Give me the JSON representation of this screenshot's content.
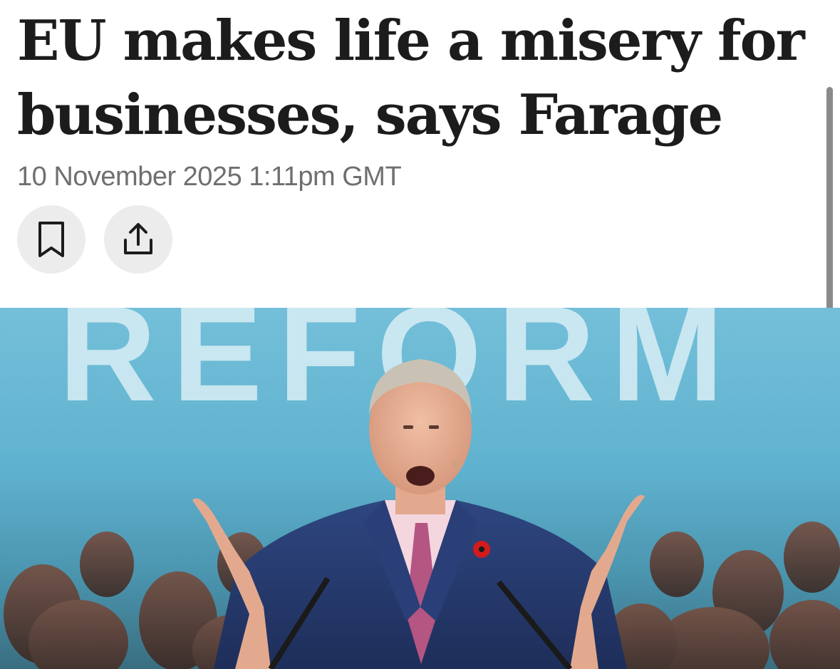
{
  "article": {
    "headline": "EU makes life a misery for businesses, says Farage",
    "timestamp": "10 November 2025 1:11pm GMT"
  },
  "actions": {
    "bookmark_icon": "bookmark-icon",
    "share_icon": "share-icon"
  },
  "hero_image": {
    "backdrop_text": "REFORM"
  },
  "colors": {
    "headline": "#1c1c1c",
    "timestamp": "#6f6f6f",
    "button_bg": "#ececec",
    "backdrop": "#5fb3d0"
  }
}
